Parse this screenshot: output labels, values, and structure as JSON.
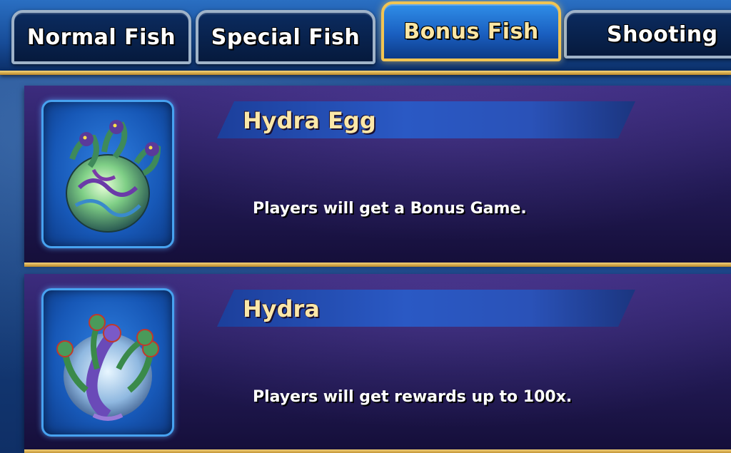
{
  "tabs": [
    {
      "label": "Normal Fish",
      "active": false
    },
    {
      "label": "Special Fish",
      "active": false
    },
    {
      "label": "Bonus Fish",
      "active": true
    },
    {
      "label": "Shooting",
      "active": false
    }
  ],
  "items": [
    {
      "name": "Hydra Egg",
      "description": "Players will get a Bonus Game.",
      "icon": "hydra-egg-icon"
    },
    {
      "name": "Hydra",
      "description": "Players will get rewards up to 100x.",
      "icon": "hydra-icon"
    }
  ],
  "colors": {
    "title_text": "#fbe7a8",
    "active_tab_border": "#f1c453",
    "card_accent": "#d98ad0",
    "gold_line": "#f3d27a"
  }
}
